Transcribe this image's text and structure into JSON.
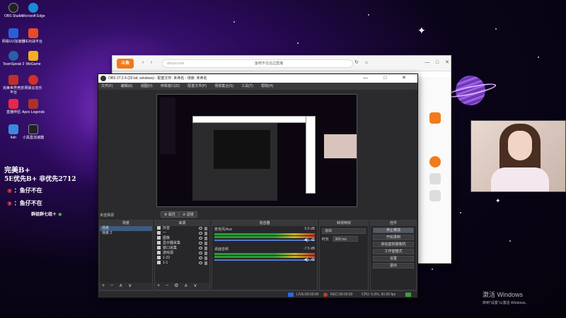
{
  "desktop": {
    "icons": [
      {
        "label": "OBS Studio",
        "color": "#222"
      },
      {
        "label": "Microsoft Edge",
        "color": "#1b8ad8"
      },
      {
        "label": "网易UU加速器",
        "color": "#2a5fd8"
      },
      {
        "label": "5E对战平台",
        "color": "#e84a2a"
      },
      {
        "label": "TeamSpeak 3",
        "color": "#2c5fa8"
      },
      {
        "label": "WeGame",
        "color": "#f0b020"
      },
      {
        "label": "完美世界竞技平台",
        "color": "#c0302a"
      },
      {
        "label": "网易云音乐",
        "color": "#d2302a"
      },
      {
        "label": "直播伴侣",
        "color": "#e8264a"
      },
      {
        "label": "Apex Legends",
        "color": "#b0302a"
      },
      {
        "label": "ltah",
        "color": "#3a8ae0"
      },
      {
        "label": "小黑盒加速器",
        "color": "#222"
      }
    ],
    "side_text": {
      "line1": "完美B+",
      "line2": "5E优先B+  非优先2712",
      "line3": "：鱼仔不在",
      "line4": "：鱼仔不在",
      "line5": "群组群七组＋"
    },
    "watermark": {
      "title": "激活 Windows",
      "subtitle": "转到\"设置\"以激活 Windows。"
    }
  },
  "browser": {
    "logo": "斗鱼",
    "url_left": "douyu.com",
    "url_text": "鱼吧不在这边直播",
    "icon_back": "‹",
    "icon_forward": "›",
    "icon_refresh": "↻",
    "icon_home": "⌂",
    "icon_min": "—",
    "icon_max": "□",
    "icon_close": "✕"
  },
  "obs": {
    "title": "OBS 27.2.4 (32-bit, windows) - 配置文件: 未命名 - 场景: 未命名",
    "win_controls": "— □ ✕",
    "menu": [
      "文件(F)",
      "编辑(E)",
      "视图(V)",
      "停靠窗口(D)",
      "配置文件(P)",
      "场景集合(S)",
      "工具(T)",
      "帮助(H)"
    ],
    "no_source_label": "未选择源",
    "properties_label": "属性",
    "filters_label": "滤镜",
    "scenes": {
      "header": "场景",
      "items": [
        "场景",
        "场景 2"
      ]
    },
    "sources": {
      "header": "来源",
      "items": [
        "抖音",
        "一",
        "图像",
        "显示器采集",
        "窗口采集",
        "游戏源",
        "1-22",
        "1-1"
      ]
    },
    "mixer": {
      "header": "混音器",
      "tracks": [
        {
          "name": "麦克风/Aux",
          "db": "0.0 dB"
        },
        {
          "name": "桌面音频",
          "db": "-7.5 dB"
        }
      ]
    },
    "transitions": {
      "header": "转场特效",
      "type": "淡出",
      "duration_label": "时长",
      "duration_value": "300 ms"
    },
    "controls": {
      "header": "控件",
      "buttons": [
        "停止推流",
        "开始录制",
        "启动虚拟摄像机",
        "工作室模式",
        "设置",
        "退出"
      ]
    },
    "footer_icons": "+ − ∧ ∨",
    "sources_footer_icons": "+ − ⚙ ∧ ∨",
    "status": {
      "live_label": "LIVE:",
      "live_time": "00:00:00",
      "rec_label": "REC:",
      "rec_time": "00:00:00",
      "cpu": "CPU: 0.0%, 60.00 fps"
    }
  }
}
